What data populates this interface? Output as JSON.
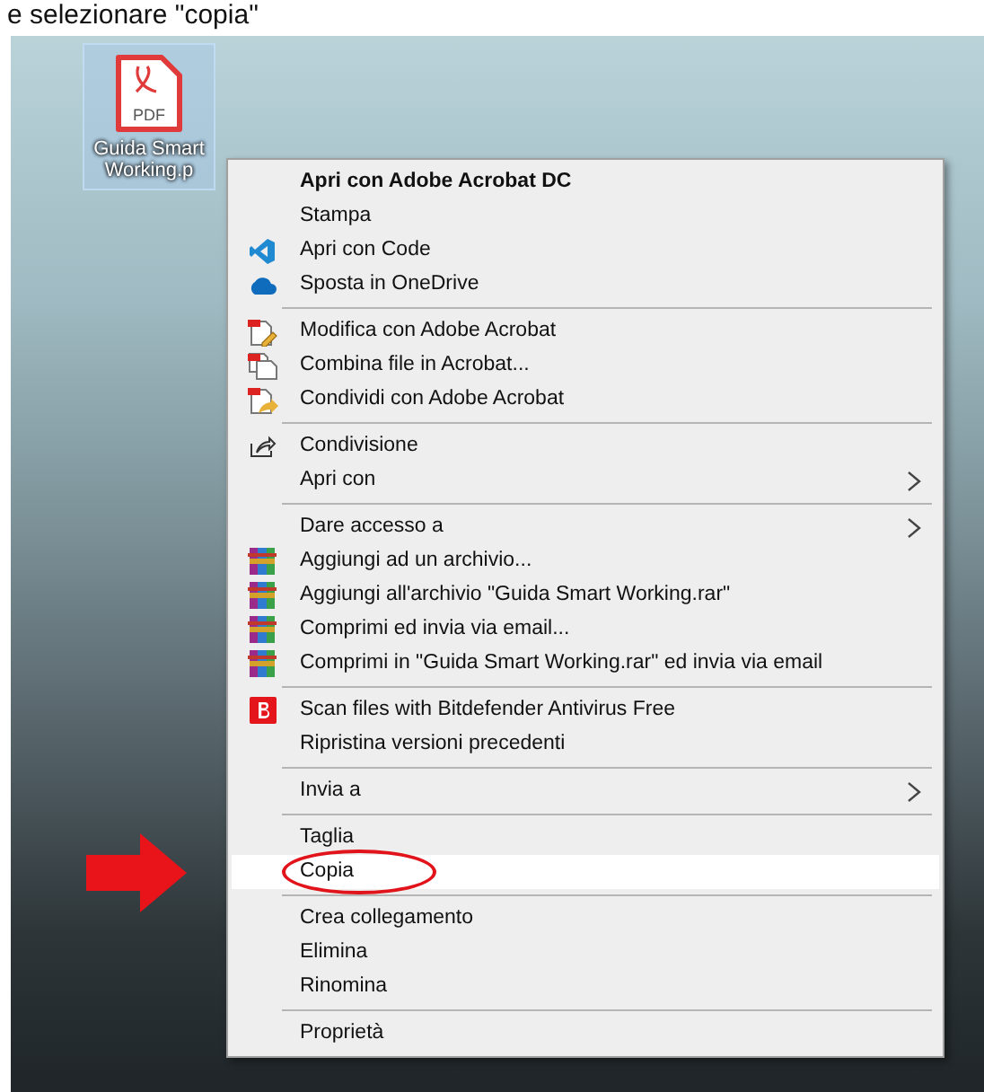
{
  "caption": "e selezionare \"copia\"",
  "desktop_icon": {
    "label": "Guida Smart Working.p",
    "badge": "PDF",
    "selected": true
  },
  "context_menu": [
    {
      "kind": "plain",
      "label": "Apri con Adobe Acrobat DC",
      "bold": true,
      "submenu": false,
      "selected": false
    },
    {
      "kind": "plain",
      "label": "Stampa",
      "bold": false,
      "submenu": false,
      "selected": false
    },
    {
      "kind": "code",
      "label": "Apri con Code",
      "bold": false,
      "submenu": false,
      "selected": false
    },
    {
      "kind": "cloud",
      "label": "Sposta in OneDrive",
      "bold": false,
      "submenu": false,
      "selected": false
    },
    {
      "kind": "separator"
    },
    {
      "kind": "pdfedit",
      "label": "Modifica con Adobe Acrobat",
      "bold": false,
      "submenu": false,
      "selected": false
    },
    {
      "kind": "pdfcombine",
      "label": "Combina file in Acrobat...",
      "bold": false,
      "submenu": false,
      "selected": false
    },
    {
      "kind": "pdfshare",
      "label": "Condividi con Adobe Acrobat",
      "bold": false,
      "submenu": false,
      "selected": false
    },
    {
      "kind": "separator"
    },
    {
      "kind": "share",
      "label": "Condivisione",
      "bold": false,
      "submenu": false,
      "selected": false
    },
    {
      "kind": "plain",
      "label": "Apri con",
      "bold": false,
      "submenu": true,
      "selected": false
    },
    {
      "kind": "separator"
    },
    {
      "kind": "plain",
      "label": "Dare accesso a",
      "bold": false,
      "submenu": true,
      "selected": false
    },
    {
      "kind": "archive",
      "label": "Aggiungi ad un archivio...",
      "bold": false,
      "submenu": false,
      "selected": false
    },
    {
      "kind": "archive",
      "label": "Aggiungi all'archivio \"Guida Smart Working.rar\"",
      "bold": false,
      "submenu": false,
      "selected": false
    },
    {
      "kind": "archive",
      "label": "Comprimi ed invia via email...",
      "bold": false,
      "submenu": false,
      "selected": false
    },
    {
      "kind": "archive",
      "label": "Comprimi in \"Guida Smart Working.rar\" ed invia via email",
      "bold": false,
      "submenu": false,
      "selected": false
    },
    {
      "kind": "separator"
    },
    {
      "kind": "antivirus",
      "label": "Scan files with Bitdefender Antivirus Free",
      "bold": false,
      "submenu": false,
      "selected": false
    },
    {
      "kind": "plain",
      "label": "Ripristina versioni precedenti",
      "bold": false,
      "submenu": false,
      "selected": false
    },
    {
      "kind": "separator"
    },
    {
      "kind": "plain",
      "label": "Invia a",
      "bold": false,
      "submenu": true,
      "selected": false
    },
    {
      "kind": "separator"
    },
    {
      "kind": "plain",
      "label": "Taglia",
      "bold": false,
      "submenu": false,
      "selected": false
    },
    {
      "kind": "plain",
      "label": "Copia",
      "bold": false,
      "submenu": false,
      "selected": true
    },
    {
      "kind": "separator"
    },
    {
      "kind": "plain",
      "label": "Crea collegamento",
      "bold": false,
      "submenu": false,
      "selected": false
    },
    {
      "kind": "plain",
      "label": "Elimina",
      "bold": false,
      "submenu": false,
      "selected": false
    },
    {
      "kind": "plain",
      "label": "Rinomina",
      "bold": false,
      "submenu": false,
      "selected": false
    },
    {
      "kind": "separator"
    },
    {
      "kind": "plain",
      "label": "Proprietà",
      "bold": false,
      "submenu": false,
      "selected": false
    }
  ]
}
